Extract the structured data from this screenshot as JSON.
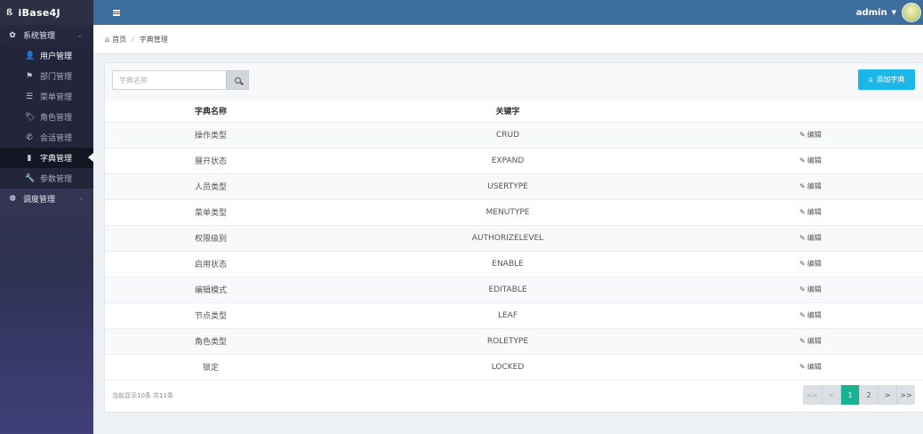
{
  "app": {
    "brand_logo": "ß",
    "brand_name": "iBase4J"
  },
  "sidebar": {
    "groups": [
      {
        "label": "系统管理",
        "icon": "gear-icon",
        "glyph": "✿",
        "chev": "⌄",
        "items": [
          {
            "label": "用户管理",
            "icon": "user-icon",
            "glyph": "👤"
          },
          {
            "label": "部门管理",
            "icon": "flag-icon",
            "glyph": "⚑"
          },
          {
            "label": "菜单管理",
            "icon": "list-icon",
            "glyph": "☰"
          },
          {
            "label": "角色管理",
            "icon": "tags-icon",
            "glyph": "🏷"
          },
          {
            "label": "会话管理",
            "icon": "phone-icon",
            "glyph": "✆"
          },
          {
            "label": "字典管理",
            "icon": "book-icon",
            "glyph": "▮"
          },
          {
            "label": "参数管理",
            "icon": "wrench-icon",
            "glyph": "🔧"
          }
        ]
      },
      {
        "label": "调度管理",
        "icon": "cogs-icon",
        "glyph": "❁",
        "chev": "›"
      }
    ]
  },
  "header": {
    "user_name": "admin",
    "caret": "▼",
    "avatar_icon": "avatar-icon"
  },
  "breadcrumb": {
    "home_glyph": "⌂",
    "home": "首页",
    "sep": "/",
    "current": "字典管理"
  },
  "toolbar": {
    "search_placeholder": "字典名称",
    "search_icon": "search-icon",
    "add_glyph": "⍝",
    "add_label": "添加字典"
  },
  "table": {
    "headers": [
      "字典名称",
      "关键字",
      ""
    ],
    "edit_glyph": "✎",
    "edit_label": "编辑",
    "rows": [
      {
        "name": "操作类型",
        "key": "CRUD"
      },
      {
        "name": "展开状态",
        "key": "EXPAND"
      },
      {
        "name": "人员类型",
        "key": "USERTYPE"
      },
      {
        "name": "菜单类型",
        "key": "MENUTYPE"
      },
      {
        "name": "权限级别",
        "key": "AUTHORIZELEVEL"
      },
      {
        "name": "启用状态",
        "key": "ENABLE"
      },
      {
        "name": "编辑模式",
        "key": "EDITABLE"
      },
      {
        "name": "节点类型",
        "key": "LEAF"
      },
      {
        "name": "角色类型",
        "key": "ROLETYPE"
      },
      {
        "name": "锁定",
        "key": "LOCKED"
      }
    ]
  },
  "footer": {
    "page_info": "当前显示10条 共11条",
    "pager": [
      {
        "label": "<<",
        "state": "disabled",
        "name": "first-page-button"
      },
      {
        "label": "<",
        "state": "disabled",
        "name": "prev-page-button"
      },
      {
        "label": "1",
        "state": "active",
        "name": "page-1-button"
      },
      {
        "label": "2",
        "state": "",
        "name": "page-2-button"
      },
      {
        "label": ">",
        "state": "",
        "name": "next-page-button"
      },
      {
        "label": ">>",
        "state": "",
        "name": "last-page-button"
      }
    ]
  },
  "colors": {
    "header": "#3c6d9d",
    "accent": "#1bb7e8",
    "active_page": "#19b394",
    "sidebar": "#2f3150"
  }
}
